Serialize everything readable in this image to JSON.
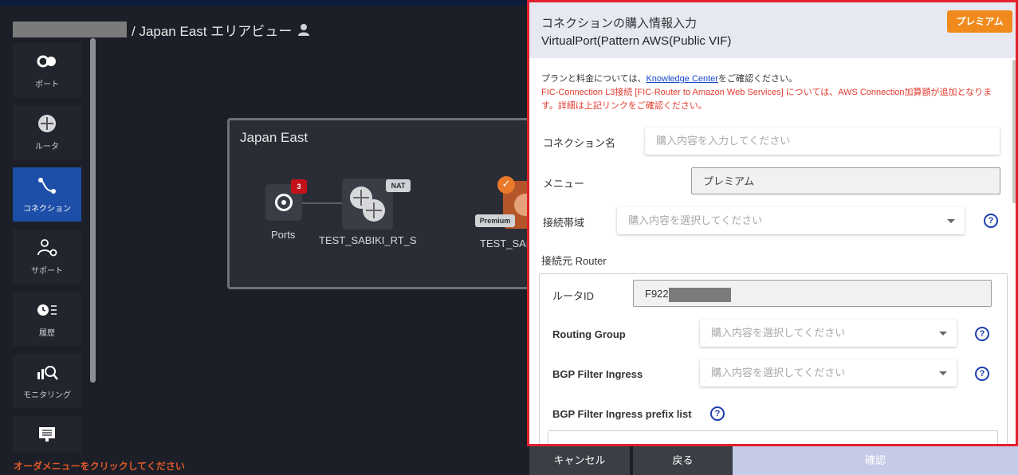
{
  "breadcrumb": {
    "area": "/ Japan East エリアビュー"
  },
  "sidebar": {
    "items": [
      {
        "label": "ポート",
        "icon": "port-icon"
      },
      {
        "label": "ルータ",
        "icon": "router-icon"
      },
      {
        "label": "コネクション",
        "icon": "connection-icon",
        "active": true
      },
      {
        "label": "サポート",
        "icon": "support-icon"
      },
      {
        "label": "履歴",
        "icon": "history-icon"
      },
      {
        "label": "モニタリング",
        "icon": "monitoring-icon"
      },
      {
        "label": "",
        "icon": "monitor-icon"
      }
    ],
    "hint": "オーダメニューをクリックしてください"
  },
  "area": {
    "title": "Japan East",
    "ports_label": "Ports",
    "ports_badge": "3",
    "router_label": "TEST_SABIKI_RT_S",
    "router_badge": "NAT",
    "connection_label": "TEST_SAB",
    "connection_badge": "Premium"
  },
  "panel": {
    "title": "コネクションの購入情報入力",
    "subtitle": "VirtualPort(Pattern AWS(Public VIF)",
    "premium_button": "プレミアム",
    "info_prefix": "プランと料金については、",
    "info_link": "Knowledge Center",
    "info_suffix": "をご確認ください。",
    "warning": "FIC-Connection L3接続 [FIC-Router to Amazon Web Services] については、AWS Connection加算額が追加となります。詳細は上記リンクをご確認ください。",
    "fields": {
      "connection_name_label": "コネクション名",
      "connection_name_placeholder": "購入内容を入力してください",
      "menu_label": "メニュー",
      "menu_value": "プレミアム",
      "bandwidth_label": "接続帯域",
      "bandwidth_placeholder": "購入内容を選択してください",
      "source_router_label": "接続元 Router",
      "router_id_label": "ルータID",
      "router_id_value": "F922",
      "routing_group_label": "Routing Group",
      "routing_group_placeholder": "購入内容を選択してください",
      "bgp_ingress_label": "BGP Filter Ingress",
      "bgp_ingress_placeholder": "購入内容を選択してください",
      "bgp_prefix_label": "BGP Filter Ingress prefix list"
    }
  },
  "footer": {
    "cancel": "キャンセル",
    "back": "戻る",
    "confirm": "確認"
  },
  "colors": {
    "accent": "#1d4ea8",
    "premium": "#f08a1c",
    "warning": "#e33a2e",
    "border_highlight": "#e3202b"
  }
}
